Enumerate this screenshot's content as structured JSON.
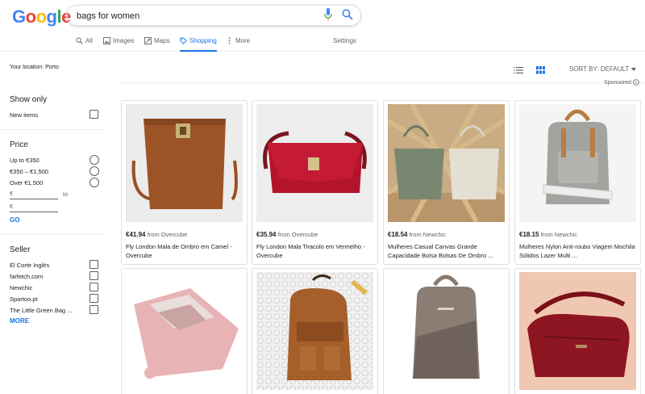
{
  "header": {
    "logo": [
      "G",
      "o",
      "o",
      "g",
      "l",
      "e"
    ],
    "logo_colors": [
      "#4285F4",
      "#EA4335",
      "#FBBC05",
      "#4285F4",
      "#34A853",
      "#EA4335"
    ],
    "search_value": "bags for women"
  },
  "tabs": {
    "all": "All",
    "images": "Images",
    "maps": "Maps",
    "shopping": "Shopping",
    "more": "More",
    "settings": "Settings"
  },
  "toolbar": {
    "location": "Your location: Porto",
    "sort_label": "SORT BY: DEFAULT",
    "sponsored": "Sponsored"
  },
  "sidebar": {
    "show_only": {
      "heading": "Show only",
      "new_items": "New items"
    },
    "price": {
      "heading": "Price",
      "options": [
        "Up to €350",
        "€350 – €1,500",
        "Over €1,500"
      ],
      "min_placeholder": "€",
      "max_placeholder": "€",
      "to": "to",
      "go": "GO"
    },
    "seller": {
      "heading": "Seller",
      "items": [
        "El Corte Inglés",
        "farfetch.com",
        "Newchic",
        "Spartoo.pt",
        "The Little Green Bag ..."
      ],
      "more": "MORE"
    }
  },
  "products": [
    {
      "price": "€41.94",
      "store": "from Overcube",
      "title": "Fly London Mala de Ombro em Camel - Overcube"
    },
    {
      "price": "€35.94",
      "store": "from Overcube",
      "title": "Fly London Mala Tiracolo em Vermelho - Overcube"
    },
    {
      "price": "€18.54",
      "store": "from Newchic",
      "title": "Mulheres Casual Canvas Grande Capacidade Bolsa Bolsas De Ombro ..."
    },
    {
      "price": "€18.15",
      "store": "from Newchic",
      "title": "Mulheres Nylon Anti-roubo Viagem Mochila Sólidos Lazer Multi ..."
    },
    {
      "price": "",
      "store": "",
      "title": ""
    },
    {
      "price": "",
      "store": "",
      "title": ""
    },
    {
      "price": "",
      "store": "",
      "title": ""
    },
    {
      "price": "",
      "store": "",
      "title": ""
    }
  ],
  "colors": {
    "accent": "#1a73e8",
    "text": "#202124",
    "muted": "#5f6368"
  }
}
